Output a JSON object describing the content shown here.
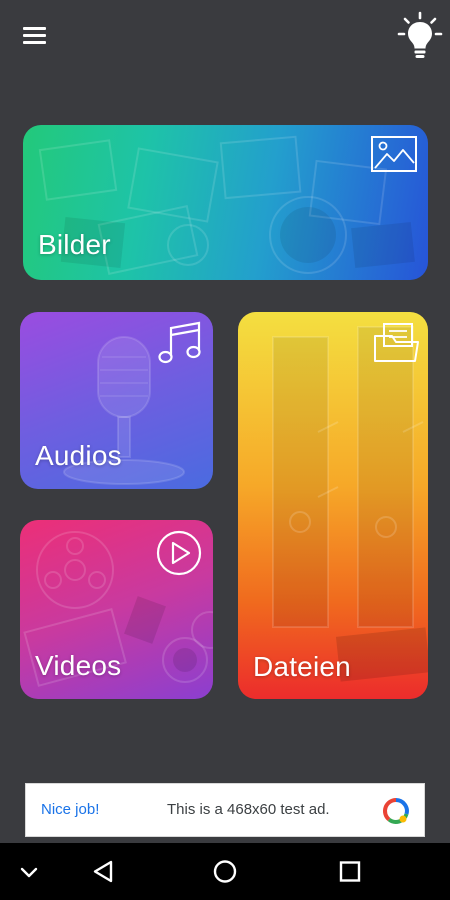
{
  "topbar": {
    "menu_icon": "hamburger-menu-icon",
    "theme_icon": "lightbulb-icon"
  },
  "cards": {
    "bilder": {
      "label": "Bilder",
      "icon": "image-icon"
    },
    "audios": {
      "label": "Audios",
      "icon": "music-note-icon"
    },
    "videos": {
      "label": "Videos",
      "icon": "play-circle-icon"
    },
    "dateien": {
      "label": "Dateien",
      "icon": "folder-icon"
    }
  },
  "ad": {
    "headline": "Nice job!",
    "text": "This is a 468x60 test ad.",
    "logo_icon": "ad-choices-logo-icon"
  },
  "navbar": {
    "items": [
      "collapse-icon",
      "back-icon",
      "home-icon",
      "recents-icon"
    ]
  },
  "colors": {
    "background": "#3a3b3f",
    "ad_link": "#1a73e8"
  }
}
